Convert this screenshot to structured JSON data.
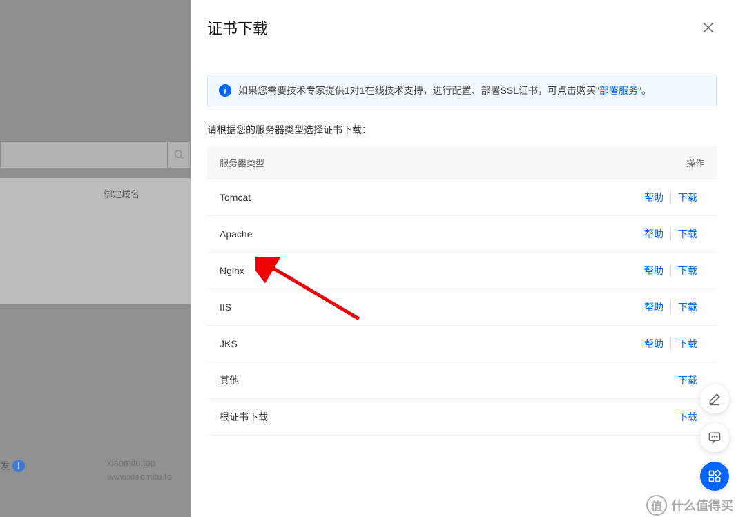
{
  "background": {
    "col_header": "绑定域名",
    "status_text": "发",
    "domain1": "xiaomitu.top",
    "domain2": "www.xiaomitu.to"
  },
  "modal": {
    "title": "证书下载",
    "info": {
      "prefix": "如果您需要技术专家提供1对1在线技术支持，进行配置、部署SSL证书，可点击购买\"",
      "link": "部署服务",
      "suffix": "\"。"
    },
    "prompt": "请根据您的服务器类型选择证书下载：",
    "thead": {
      "col1": "服务器类型",
      "col2": "操作"
    },
    "rows": [
      {
        "name": "Tomcat",
        "help": "帮助",
        "download": "下载"
      },
      {
        "name": "Apache",
        "help": "帮助",
        "download": "下载"
      },
      {
        "name": "Nginx",
        "help": "帮助",
        "download": "下载"
      },
      {
        "name": "IIS",
        "help": "帮助",
        "download": "下载"
      },
      {
        "name": "JKS",
        "help": "帮助",
        "download": "下载"
      },
      {
        "name": "其他",
        "help": "",
        "download": "下载"
      },
      {
        "name": "根证书下载",
        "help": "",
        "download": "下载"
      }
    ]
  },
  "watermark": {
    "badge": "值",
    "text": "什么值得买"
  }
}
